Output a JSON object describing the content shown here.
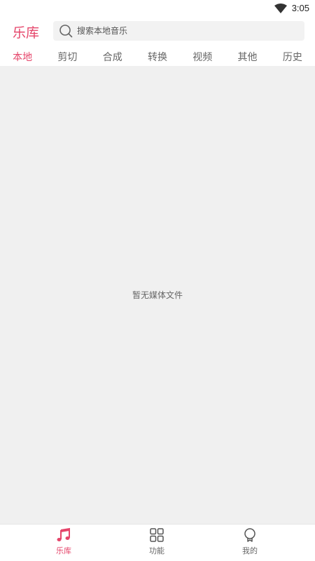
{
  "status_bar": {
    "time": "3:05"
  },
  "header": {
    "title": "乐库",
    "search_placeholder": "搜索本地音乐"
  },
  "tabs": [
    {
      "label": "本地",
      "active": true
    },
    {
      "label": "剪切",
      "active": false
    },
    {
      "label": "合成",
      "active": false
    },
    {
      "label": "转换",
      "active": false
    },
    {
      "label": "视频",
      "active": false
    },
    {
      "label": "其他",
      "active": false
    },
    {
      "label": "历史",
      "active": false
    }
  ],
  "main": {
    "empty_message": "暂无媒体文件"
  },
  "bottom_nav": [
    {
      "label": "乐库",
      "icon": "music-note-icon",
      "active": true
    },
    {
      "label": "功能",
      "icon": "grid-icon",
      "active": false
    },
    {
      "label": "我的",
      "icon": "profile-icon",
      "active": false
    }
  ],
  "colors": {
    "accent": "#e5456a",
    "background": "#f0f0f0",
    "inactive_text": "#666666"
  }
}
